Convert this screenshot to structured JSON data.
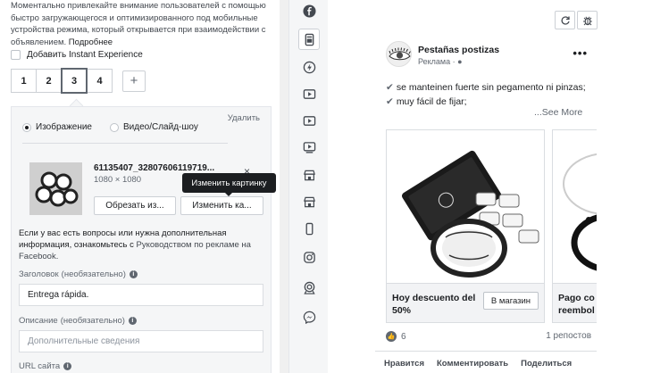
{
  "editor": {
    "intro_text": "Моментально привлекайте внимание пользователей с помощью быстро загружающегося и оптимизированного под мобильные устройства режима, который открывается при взаимодействии с объявлением.",
    "intro_more": "Подробнее",
    "instant_experience_label": "Добавить Instant Experience",
    "steps": [
      "1",
      "2",
      "3",
      "4"
    ],
    "active_step": "3",
    "add_step": "+",
    "remove_label": "Удалить",
    "media_types": [
      "Изображение",
      "Видео/Слайд-шоу"
    ],
    "selected_media": "Изображение",
    "file": {
      "name": "61135407_32807606119719...",
      "dimensions": "1080 × 1080",
      "close": "×"
    },
    "tooltip": "Изменить картинку",
    "crop_button": "Обрезать из...",
    "change_button": "Изменить ка...",
    "help_text": "Если у вас есть вопросы или нужна дополнительная информация, ознакомьтесь с",
    "help_link": "Руководством по рекламе на Facebook.",
    "headline_label": "Заголовок",
    "headline_optional": "(необязательно)",
    "headline_value": "Entrega rápida.",
    "description_label": "Описание",
    "description_optional": "(необязательно)",
    "description_placeholder": "Дополнительные сведения",
    "url_label": "URL сайта"
  },
  "rail": {
    "icons": [
      "facebook-icon",
      "feed-icon",
      "instant-articles-icon",
      "in-stream-video-icon",
      "video-feed-icon",
      "marketplace-icon",
      "stories-icon",
      "store-icon",
      "mobile-icon",
      "instagram-icon",
      "audience-network-icon",
      "messenger-icon"
    ],
    "active_index": 1
  },
  "preview": {
    "toolbar": [
      "refresh-icon",
      "bug-icon"
    ],
    "page_name": "Pestañas postizas",
    "sponsored": "Реклама",
    "globe": "·",
    "menu": "•••",
    "lines": [
      "se manteinen fuerte sin pegamento ni pinzas;",
      "muy fácil de fijar;"
    ],
    "see_more": "...See More",
    "cards": [
      {
        "title": "Hoy descuento del 50%",
        "button": "В магазин"
      },
      {
        "title": "Pago co reembol",
        "button": ""
      }
    ],
    "reactions_count": "6",
    "shares": "1 репостов",
    "actions": [
      "Нравится",
      "Комментировать",
      "Поделиться"
    ]
  }
}
